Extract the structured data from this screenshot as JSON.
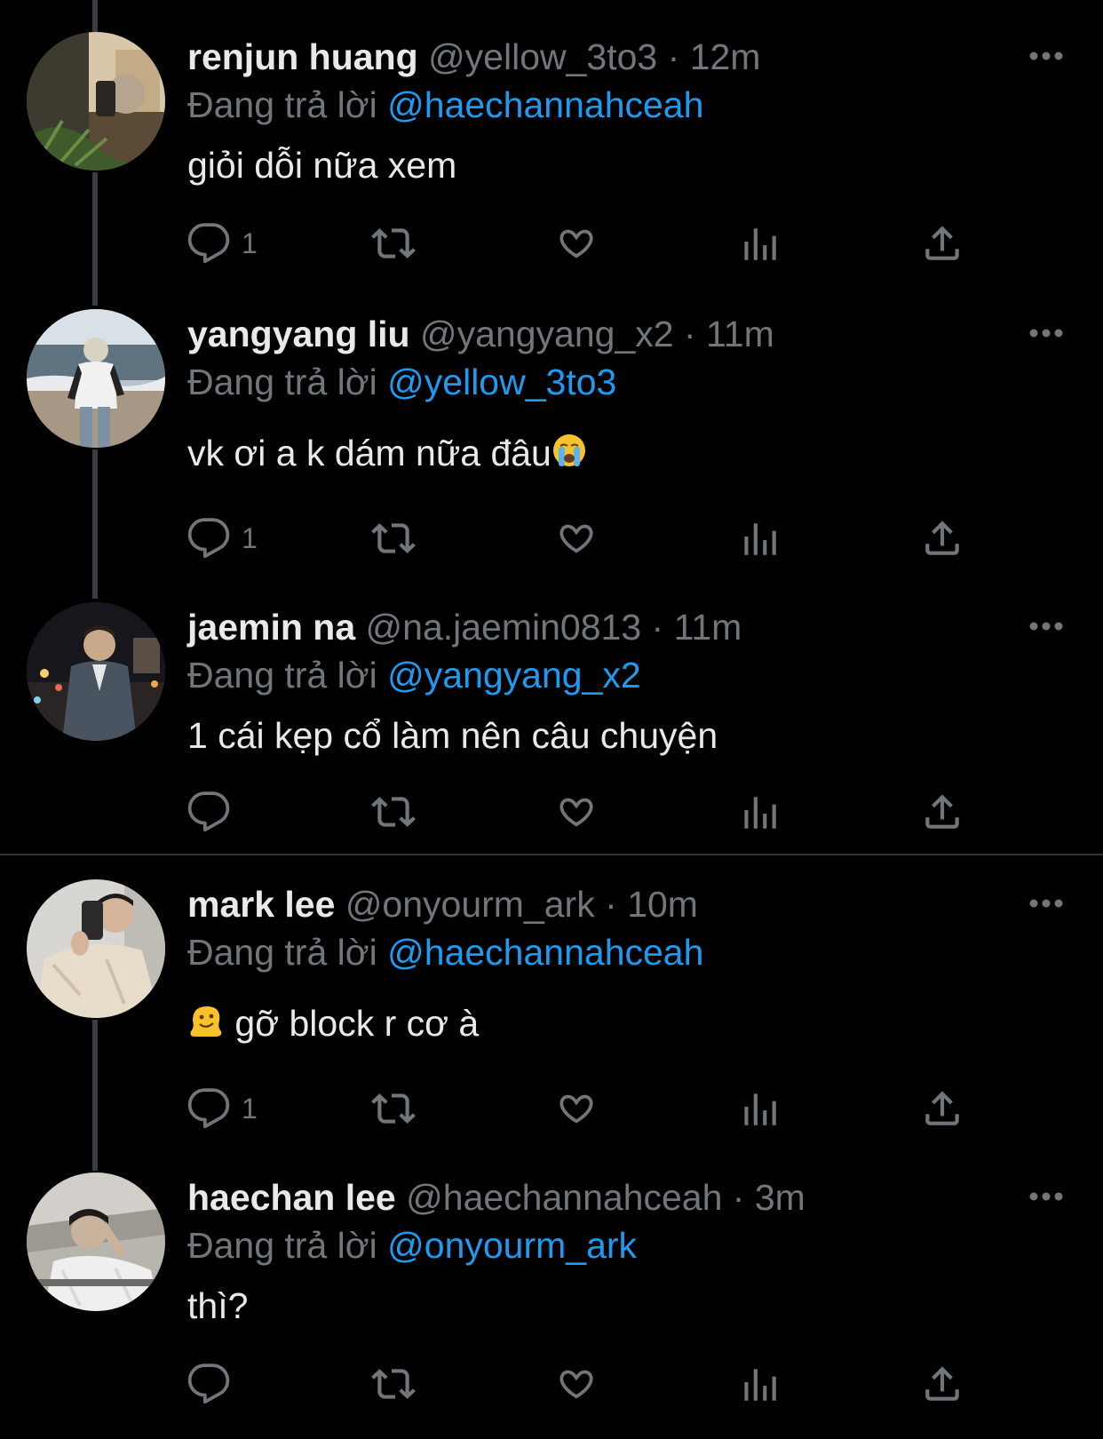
{
  "labels": {
    "replying_to": "Đang trả lời"
  },
  "colors": {
    "background": "#000000",
    "text": "#e7e9ea",
    "muted": "#71767b",
    "accent": "#1d9bf0",
    "thread_line": "#3a3d41"
  },
  "tweets": [
    {
      "name": "renjun huang",
      "handle": "@yellow_3to3",
      "separator": "·",
      "time": "12m",
      "reply_to": "@haechannahceah",
      "text": "giỏi dỗi nữa xem",
      "reply_count": "1"
    },
    {
      "name": "yangyang liu",
      "handle": "@yangyang_x2",
      "separator": "·",
      "time": "11m",
      "reply_to": "@yellow_3to3",
      "text": "vk ơi a k dám nữa đâu",
      "text_emoji": "loudly-crying-face-emoji",
      "reply_count": "1"
    },
    {
      "name": "jaemin na",
      "handle": "@na.jaemin0813",
      "separator": "·",
      "time": "11m",
      "reply_to": "@yangyang_x2",
      "text": "1 cái kẹp cổ làm nên câu chuyện",
      "reply_count": ""
    },
    {
      "name": "mark lee",
      "handle": "@onyourm_ark",
      "separator": "·",
      "time": "10m",
      "reply_to": "@haechannahceah",
      "text": "gỡ block r cơ à",
      "text_emoji": "melting-face-emoji",
      "reply_count": "1"
    },
    {
      "name": "haechan lee",
      "handle": "@haechannahceah",
      "separator": "·",
      "time": "3m",
      "reply_to": "@onyourm_ark",
      "text": "thì?",
      "reply_count": ""
    }
  ],
  "icons": [
    "more-icon",
    "reply-icon",
    "retweet-icon",
    "like-icon",
    "views-icon",
    "share-icon"
  ]
}
